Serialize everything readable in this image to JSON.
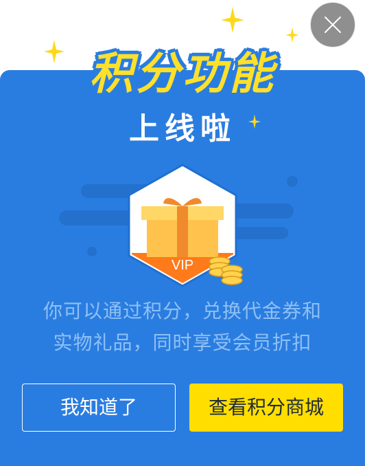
{
  "dialog": {
    "title": "积分功能",
    "subtitle": "上线啦",
    "description_line1": "你可以通过积分，兑换代金券和",
    "description_line2": "实物礼品，同时享受会员折扣",
    "badge_text": "VIP",
    "secondary_button": "我知道了",
    "primary_button": "查看积分商城"
  },
  "icons": {
    "close": "close-icon",
    "gift": "gift-icon",
    "coins": "coins-icon",
    "sparkle": "sparkle-icon"
  },
  "colors": {
    "background": "#2a7de0",
    "title": "#ffe02a",
    "primary_button": "#ffde00",
    "badge": "#ff7a1a"
  }
}
